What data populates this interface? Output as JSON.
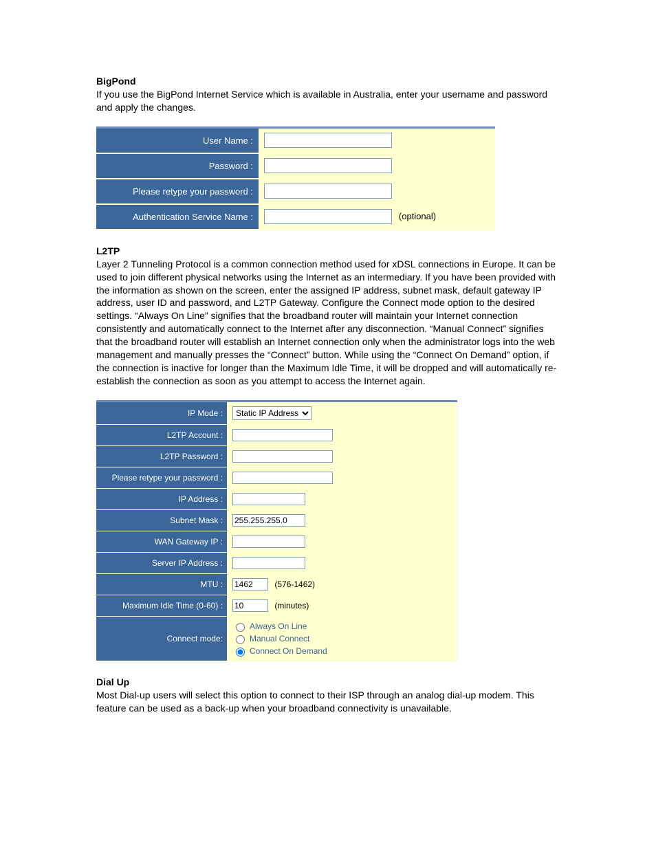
{
  "bigpond": {
    "heading": "BigPond",
    "description": "If you use the BigPond Internet Service which is available in Australia, enter your username and password and apply the changes.",
    "fields": {
      "user_name_label": "User Name :",
      "password_label": "Password :",
      "retype_password_label": "Please retype your password :",
      "auth_service_label": "Authentication Service Name :",
      "auth_service_note": "(optional)"
    },
    "values": {
      "user_name": "",
      "password": "",
      "retype_password": "",
      "auth_service": ""
    }
  },
  "l2tp": {
    "heading": "L2TP",
    "description": "Layer 2 Tunneling Protocol is a common connection method used for xDSL connections in Europe. It can be used to join different physical networks using the Internet as an intermediary. If you have been provided with the information as shown on the screen, enter the assigned IP address, subnet mask, default gateway IP address, user ID and password, and L2TP Gateway. Configure the Connect mode option to the desired settings. “Always On Line” signifies that the broadband router will maintain your Internet connection consistently and automatically connect to the Internet after any disconnection. “Manual Connect” signifies that the broadband router will establish an Internet connection only when the administrator logs into the web management and manually presses the “Connect” button. While using the “Connect On Demand” option, if the connection is inactive for longer than the Maximum Idle Time, it will be dropped and will automatically re-establish the connection as soon as you attempt to access the Internet again.",
    "fields": {
      "ip_mode_label": "IP Mode :",
      "account_label": "L2TP Account :",
      "password_label": "L2TP Password :",
      "retype_password_label": "Please retype your password :",
      "ip_address_label": "IP Address :",
      "subnet_mask_label": "Subnet Mask :",
      "wan_gateway_label": "WAN Gateway IP :",
      "server_ip_label": "Server IP Address :",
      "mtu_label": "MTU :",
      "mtu_range": "(576-1462)",
      "max_idle_label": "Maximum Idle Time (0-60) :",
      "max_idle_unit": "(minutes)",
      "connect_mode_label": "Connect mode:"
    },
    "values": {
      "ip_mode_selected": "Static IP Address",
      "account": "",
      "password": "",
      "retype_password": "",
      "ip_address": "",
      "subnet_mask": "255.255.255.0",
      "wan_gateway": "",
      "server_ip": "",
      "mtu": "1462",
      "max_idle": "10"
    },
    "connect_mode_options": {
      "always": "Always On Line",
      "manual": "Manual Connect",
      "demand": "Connect On Demand"
    },
    "connect_mode_selected": "demand"
  },
  "dialup": {
    "heading": "Dial Up",
    "description": "Most Dial-up users will select this option to connect to their ISP through an analog dial-up modem. This feature can be used as a back-up when your broadband connectivity is unavailable."
  }
}
